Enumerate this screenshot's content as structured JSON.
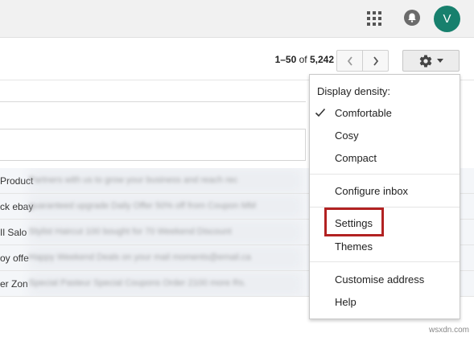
{
  "header": {
    "avatar_letter": "V",
    "icons": [
      "apps-grid-icon",
      "notification-icon"
    ],
    "colors": {
      "avatar": "#17806d",
      "topbar": "#f1f1f1"
    }
  },
  "toolbar": {
    "count_range": "1–50",
    "count_of": "of",
    "count_total": "5,242",
    "prev_icon": "chevron-left-icon",
    "next_icon": "chevron-right-icon",
    "settings_icon": "gear-icon"
  },
  "email_rows": [
    {
      "sender": "Product",
      "snippet": "Partners with us to grow your business and reach rec"
    },
    {
      "sender": "ck ebay",
      "snippet": "guaranteed upgrade Daily Offer 50% off from Coupon MM"
    },
    {
      "sender": "Il Salo",
      "snippet": "Stylist Haircut 100 bought for 70 Weekend Discount"
    },
    {
      "sender": "oy offe",
      "snippet": "Happy Weekend Deals on your mail moments@email.ca"
    },
    {
      "sender": "er Zon",
      "snippet": "Special Pasteur Special Coupons Order 2100 more Rs."
    }
  ],
  "menu": {
    "heading": "Display density:",
    "density_options": [
      {
        "label": "Comfortable",
        "checked": true
      },
      {
        "label": "Cosy",
        "checked": false
      },
      {
        "label": "Compact",
        "checked": false
      }
    ],
    "configure": "Configure inbox",
    "settings": "Settings",
    "themes": "Themes",
    "customise": "Customise address",
    "help": "Help",
    "highlight_color": "#b22222"
  },
  "watermark": "wsxdn.com"
}
